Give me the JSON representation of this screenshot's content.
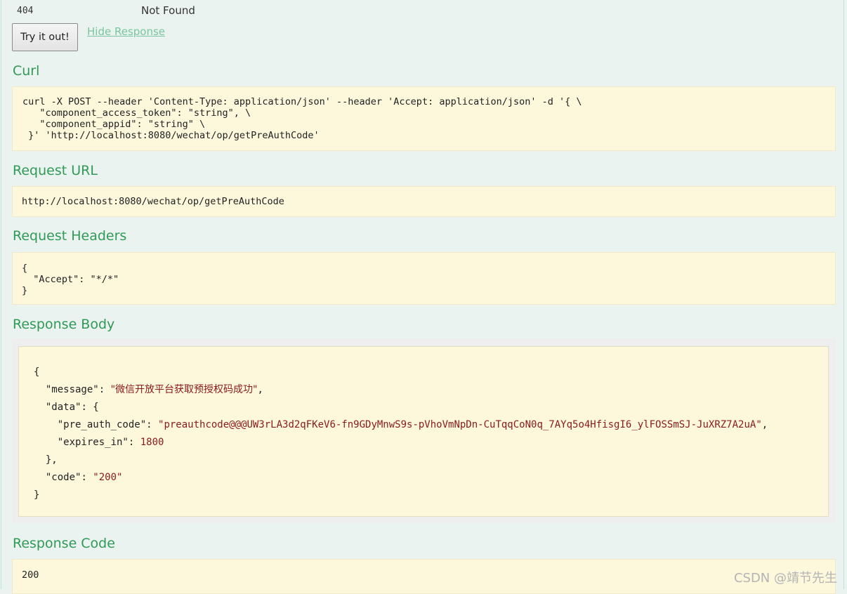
{
  "status": {
    "code": "404",
    "description": "Not Found"
  },
  "actions": {
    "try_label": "Try it out!",
    "hide_label": "Hide Response"
  },
  "sections": {
    "curl": {
      "title": "Curl",
      "lines": [
        "curl -X POST --header 'Content-Type: application/json' --header 'Accept: application/json' -d '{ \\",
        "   \"component_access_token\": \"string\", \\",
        "   \"component_appid\": \"string\" \\",
        " }' 'http://localhost:8080/wechat/op/getPreAuthCode'"
      ]
    },
    "request_url": {
      "title": "Request URL",
      "value": "http://localhost:8080/wechat/op/getPreAuthCode"
    },
    "request_headers": {
      "title": "Request Headers",
      "lines": [
        "{",
        "  \"Accept\": \"*/*\"",
        "}"
      ]
    },
    "response_body": {
      "title": "Response Body",
      "open_brace": "{",
      "message_key": "\"message\"",
      "message_value": "\"微信开放平台获取预授权码成功\"",
      "data_key": "\"data\"",
      "pre_auth_code_key": "\"pre_auth_code\"",
      "pre_auth_code_value": "\"preauthcode@@@UW3rLA3d2qFKeV6-fn9GDyMnwS9s-pVhoVmNpDn-CuTqqCoN0q_7AYq5o4HfisgI6_ylFOSSmSJ-JuXRZ7A2uA\"",
      "expires_in_key": "\"expires_in\"",
      "expires_in_value": "1800",
      "data_close": "},",
      "code_key": "\"code\"",
      "code_value": "\"200\"",
      "close_brace": "}"
    },
    "response_code": {
      "title": "Response Code",
      "value": "200"
    }
  },
  "watermark": "CSDN @靖节先生",
  "colors": {
    "accent": "#2f9a55",
    "link": "#78c6a0",
    "code_bg": "#fdf7dc",
    "string": "#8b1a1a"
  }
}
